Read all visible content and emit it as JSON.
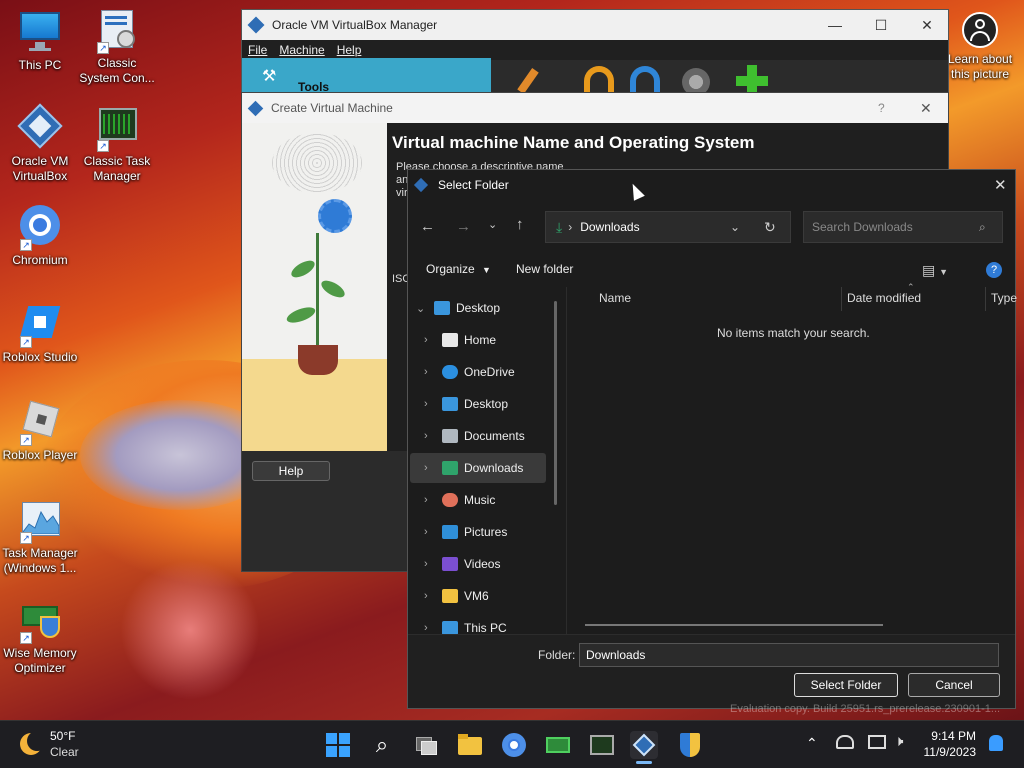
{
  "desktop": {
    "icons": [
      {
        "label": "This PC"
      },
      {
        "label": "Classic System Con..."
      },
      {
        "label": "Oracle VM VirtualBox"
      },
      {
        "label": "Classic Task Manager"
      },
      {
        "label": "Chromium"
      },
      {
        "label": "Roblox Studio"
      },
      {
        "label": "Roblox Player"
      },
      {
        "label": "Task Manager (Windows 1..."
      },
      {
        "label": "Wise Memory Optimizer"
      }
    ],
    "learn_more": "Learn about this picture"
  },
  "vbox_manager": {
    "title": "Oracle VM VirtualBox Manager",
    "menu": [
      "File",
      "Machine",
      "Help"
    ],
    "tools_label": "Tools"
  },
  "create_vm": {
    "title": "Create Virtual Machine",
    "help_glyph": "?",
    "heading": "Virtual machine Name and Operating System",
    "description": "Please choose a descriptive name and destination folder for the new virtual machine. The name you choose will be used throughout VirtualBox to identify this machine. Additionally, you can select an ISO image...",
    "iso_label": "ISO",
    "help_button": "Help",
    "watermark": "Evaluation copy. Build 25951.rs_prerelease.230901-1..."
  },
  "select_folder": {
    "title": "Select Folder",
    "breadcrumb_current": "Downloads",
    "search_placeholder": "Search Downloads",
    "organize_label": "Organize",
    "new_folder_label": "New folder",
    "columns": [
      "Name",
      "Date modified",
      "Type"
    ],
    "empty_message": "No items match your search.",
    "tree": [
      {
        "label": "Desktop",
        "expanded": true,
        "color": "#3a96dd"
      },
      {
        "label": "Home",
        "color": "#e8e8e8"
      },
      {
        "label": "OneDrive",
        "color": "#2b8fe0"
      },
      {
        "label": "Desktop",
        "color": "#3a96dd"
      },
      {
        "label": "Documents",
        "color": "#b0b8c0"
      },
      {
        "label": "Downloads",
        "selected": true,
        "color": "#2fa36b"
      },
      {
        "label": "Music",
        "color": "#e0705a"
      },
      {
        "label": "Pictures",
        "color": "#2f8fd8"
      },
      {
        "label": "Videos",
        "color": "#7b4fd1"
      },
      {
        "label": "VM6",
        "color": "#f2c240"
      },
      {
        "label": "This PC",
        "color": "#3a96dd"
      }
    ],
    "folder_label": "Folder:",
    "folder_value": "Downloads",
    "select_button": "Select Folder",
    "cancel_button": "Cancel"
  },
  "taskbar": {
    "weather_temp": "50°F",
    "weather_desc": "Clear",
    "time": "9:14 PM",
    "date": "11/9/2023"
  }
}
